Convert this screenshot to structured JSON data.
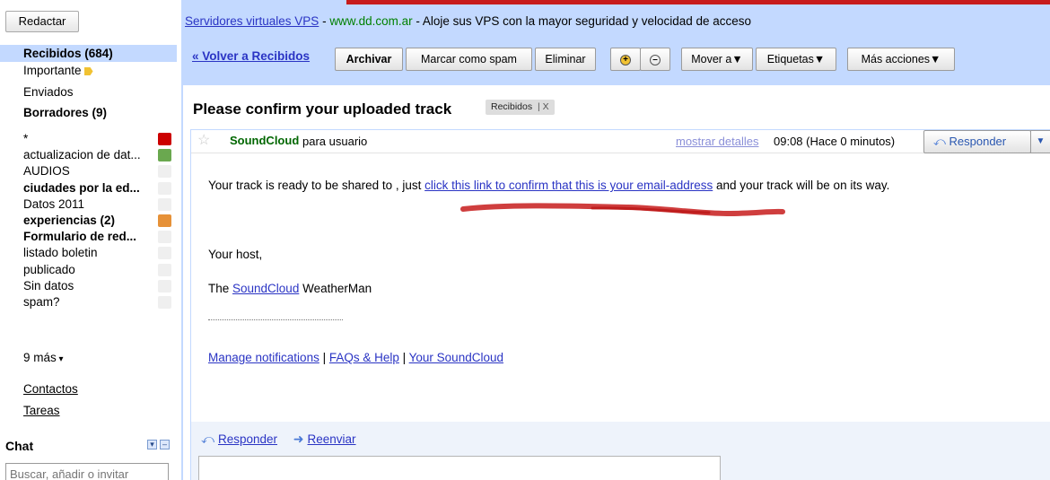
{
  "nav": {
    "compose_label": "Redactar",
    "inbox_label": "Recibidos (684)",
    "important_label": "Importante",
    "sent_label": "Enviados",
    "drafts_label": "Borradores (9)",
    "labels": [
      {
        "name": "*",
        "bold": false,
        "color": "#cc0000"
      },
      {
        "name": "actualizacion de dat...",
        "bold": false,
        "color": "#6aa84f"
      },
      {
        "name": "AUDIOS",
        "bold": false,
        "color": "#efefef"
      },
      {
        "name": "ciudades por la ed...",
        "bold": true,
        "color": "#efefef"
      },
      {
        "name": "Datos 2011",
        "bold": false,
        "color": "#efefef"
      },
      {
        "name": "experiencias (2)",
        "bold": true,
        "color": "#e69138"
      },
      {
        "name": "Formulario de red...",
        "bold": true,
        "color": "#efefef"
      },
      {
        "name": "listado boletin",
        "bold": false,
        "color": "#efefef"
      },
      {
        "name": "publicado",
        "bold": false,
        "color": "#efefef"
      },
      {
        "name": "Sin datos",
        "bold": false,
        "color": "#efefef"
      },
      {
        "name": "spam?",
        "bold": false,
        "color": "#efefef"
      }
    ],
    "more_label": "9 más",
    "contacts_label": "Contactos",
    "tasks_label": "Tareas",
    "chat_title": "Chat",
    "chat_search_placeholder": "Buscar, añadir o invitar"
  },
  "ad": {
    "link": "Servidores virtuales VPS",
    "separator1": " - ",
    "url": "www.dd.com.ar",
    "text": " - Aloje sus VPS con la mayor seguridad y velocidad de acceso"
  },
  "toolbar": {
    "back_label": "« Volver a Recibidos",
    "archive_label": "Archivar",
    "spam_label": "Marcar como spam",
    "delete_label": "Eliminar",
    "move_label": "Mover a▼",
    "labels_label": "Etiquetas▼",
    "more_label": "Más acciones▼"
  },
  "message": {
    "subject": "Please confirm your uploaded track",
    "label_chip": "Recibidos",
    "label_chip_x": "X",
    "sender": "SoundCloud",
    "to_text": "para usuario",
    "details_link": "mostrar detalles",
    "time": "09:08 (Hace 0 minutos)",
    "reply_button": "Responder",
    "body_line1_pre": "Your track is ready to be shared to , just ",
    "body_line1_link": "click this link to confirm that this is your email-address",
    "body_line1_post": " and your track will be on its way.",
    "host_line": "Your host,",
    "sign_pre": "The ",
    "sign_link": "SoundCloud",
    "sign_post": " WeatherMan",
    "footer_link1": "Manage notifications",
    "footer_sep1": " | ",
    "footer_link2": "FAQs & Help",
    "footer_sep2": " | ",
    "footer_link3": "Your SoundCloud"
  },
  "reply_bar": {
    "reply_label": "Responder",
    "forward_label": "Reenviar"
  },
  "colors": {
    "accent_blue": "#c3d9ff",
    "link": "#2a34c4",
    "sender_green": "#006600",
    "annotation_red": "#c71c1c"
  }
}
